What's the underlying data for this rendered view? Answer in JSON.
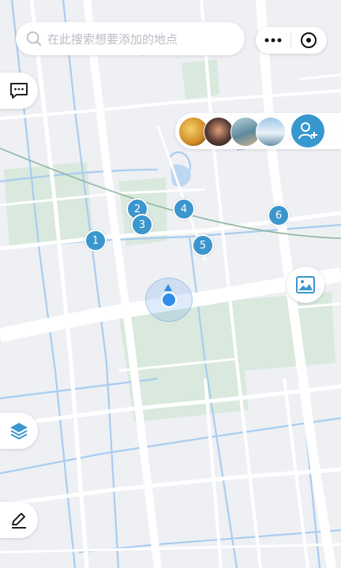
{
  "search": {
    "placeholder": "在此搜索想要添加的地点"
  },
  "capsule": {
    "more_icon": "ellipsis-icon",
    "close_icon": "close-circle-icon"
  },
  "side_buttons": {
    "chat_icon": "chat-bubble-icon",
    "layers_icon": "layers-icon",
    "edit_icon": "pencil-icon"
  },
  "avatars": {
    "count": 4,
    "add_icon": "add-user-icon",
    "accent": "#3798cf"
  },
  "photo_button": {
    "icon": "image-icon"
  },
  "markers": [
    {
      "label": "1"
    },
    {
      "label": "2"
    },
    {
      "label": "3"
    },
    {
      "label": "4"
    },
    {
      "label": "5"
    },
    {
      "label": "6"
    }
  ],
  "colors": {
    "marker": "#3b96cd",
    "water": "#a9cdf0",
    "park": "#d8e8dc",
    "road": "#ffffff",
    "land": "#eef0f4"
  }
}
